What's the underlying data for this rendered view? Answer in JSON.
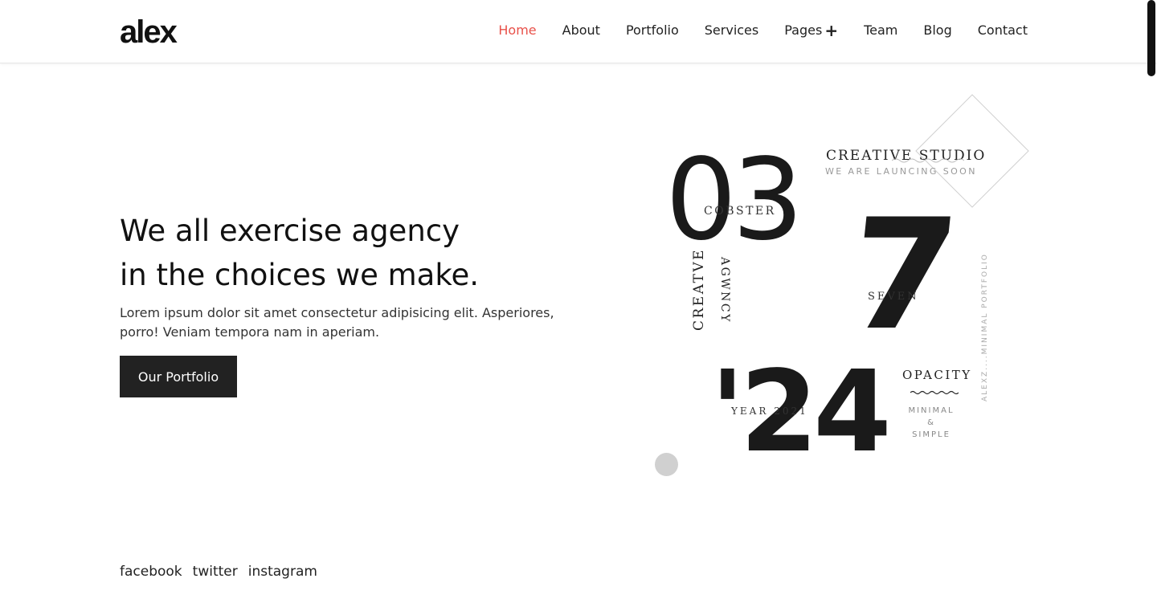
{
  "header": {
    "logo": "alex",
    "nav": [
      {
        "label": "Home",
        "active": true
      },
      {
        "label": "About"
      },
      {
        "label": "Portfolio"
      },
      {
        "label": "Services"
      },
      {
        "label": "Pages",
        "icon": "plus-icon"
      },
      {
        "label": "Team"
      },
      {
        "label": "Blog"
      },
      {
        "label": "Contact"
      }
    ]
  },
  "hero": {
    "title_line1": "We all exercise agency",
    "title_line2": "in the choices we make.",
    "description": "Lorem ipsum dolor sit amet consectetur adipisicing elit. Asperiores, porro! Veniam tempora nam in aperiam.",
    "button_label": "Our Portfolio"
  },
  "collage": {
    "big_03": "03",
    "big_7": "7",
    "big_24": "'24",
    "creative_studio": "CREATIVE STUDIO",
    "launching": "WE ARE LAUNCING SOON",
    "cobster": "COBSTER",
    "creative_vertical": "CREATVE",
    "agency_vertical": "AGWNCY",
    "seven_label": "SEVEN",
    "year_label": "YEAR 2021",
    "opacity": "OPACITY",
    "minimal": "MINIMAL",
    "amp": "&",
    "simple": "SIMPLE",
    "alexz": "ALEXZ....MINIMAL PORTFOLIO"
  },
  "social": [
    "facebook",
    "twitter",
    "instagram"
  ],
  "colors": {
    "accent": "#e8514a",
    "button_bg": "#222222"
  }
}
